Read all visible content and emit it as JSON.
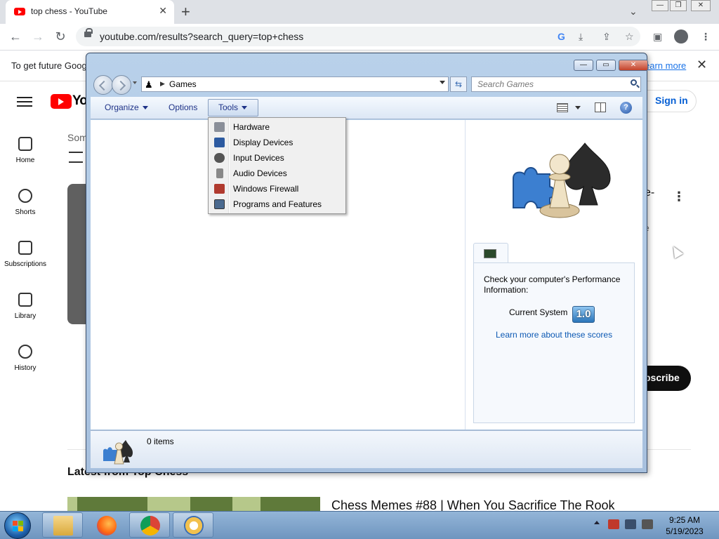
{
  "browser": {
    "tab_title": "top chess - YouTube",
    "tab_close": "✕",
    "new_tab": "+",
    "url": "youtube.com/results?search_query=top+chess",
    "infobar_text": "To get future Goog",
    "infobar_link": "earn more",
    "infobar_close": "✕"
  },
  "youtube": {
    "logo_text": "Yo",
    "sign_in": "Sign in",
    "sidebar": [
      {
        "label": "Home",
        "icon": "home-icon"
      },
      {
        "label": "Shorts",
        "icon": "shorts-icon"
      },
      {
        "label": "Subscriptions",
        "icon": "subscriptions-icon"
      },
      {
        "label": "Library",
        "icon": "library-icon"
      },
      {
        "label": "History",
        "icon": "history-icon"
      }
    ],
    "partial_text": "Som",
    "video_title_partial": "e-",
    "video_meta_partial": "e",
    "subscribe": "bscribe",
    "latest_heading": "Latest from Top Chess",
    "video2_title": "Chess Memes #88 | When You Sacrifice The Rook"
  },
  "explorer": {
    "address_crumb": "Games",
    "search_placeholder": "Search Games",
    "cmd": {
      "organize": "Organize",
      "options": "Options",
      "tools": "Tools"
    },
    "tools_menu": [
      {
        "label": "Hardware",
        "icon": "hardware-icon",
        "color": "#8a8f99"
      },
      {
        "label": "Display Devices",
        "icon": "display-icon",
        "color": "#2c5aa0"
      },
      {
        "label": "Input Devices",
        "icon": "gamepad-icon",
        "color": "#555555"
      },
      {
        "label": "Audio Devices",
        "icon": "speaker-icon",
        "color": "#888888"
      },
      {
        "label": "Windows Firewall",
        "icon": "firewall-icon",
        "color": "#b03a2e"
      },
      {
        "label": "Programs and Features",
        "icon": "programs-icon",
        "color": "#4b6a8f"
      }
    ],
    "wei_description": "Check your computer's Performance Information:",
    "wei_current": "Current System",
    "wei_score": "1.0",
    "wei_link": "Learn more about these scores",
    "status_items": "0 items",
    "help": "?"
  },
  "taskbar": {
    "time": "9:25 AM",
    "date": "5/19/2023",
    "apps": [
      "explorer-icon",
      "firefox-icon",
      "chrome-icon",
      "app-icon"
    ]
  },
  "colors": {
    "youtube_red": "#ff0000",
    "link_blue": "#0b58b3",
    "taskbar": "#7fa3c9"
  }
}
